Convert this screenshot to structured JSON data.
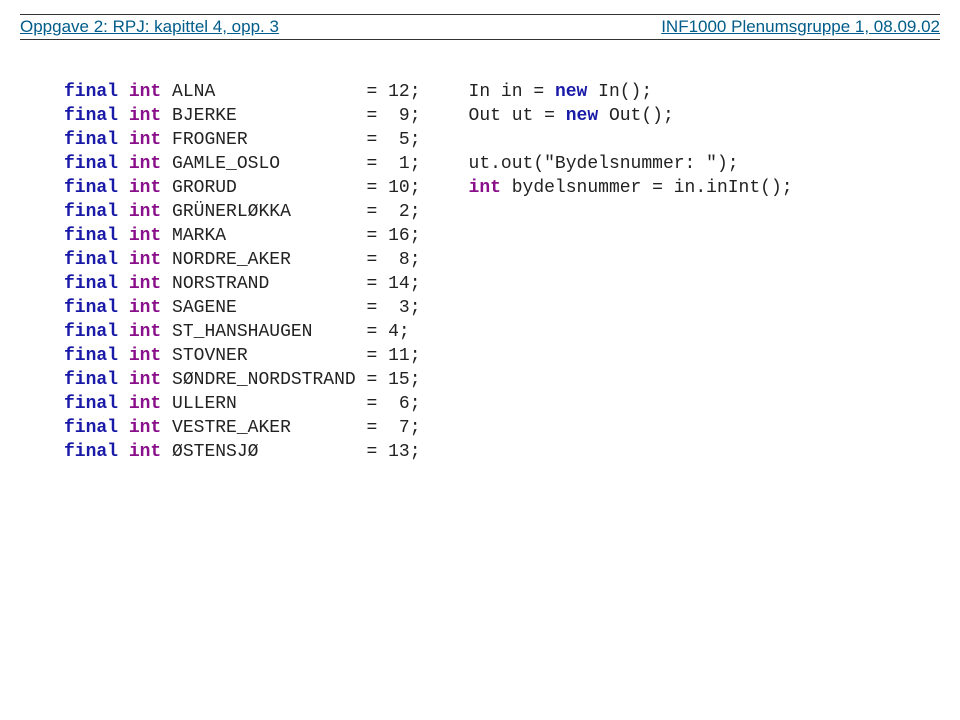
{
  "header": {
    "left": "Oppgave 2: RPJ: kapittel 4, opp. 3",
    "right": "INF1000  Plenumsgruppe 1, 08.09.02"
  },
  "code": {
    "kw_final": "final",
    "kw_int": "int",
    "kw_new": "new",
    "lines_left": [
      {
        "name": "ALNA",
        "eq": "= 12;"
      },
      {
        "name": "BJERKE",
        "eq": "=  9;"
      },
      {
        "name": "FROGNER",
        "eq": "=  5;"
      },
      {
        "name": "GAMLE_OSLO",
        "eq": "=  1;"
      },
      {
        "name": "GRORUD",
        "eq": "= 10;"
      },
      {
        "name": "GRÜNERLØKKA",
        "eq": "=  2;"
      },
      {
        "name": "MARKA",
        "eq": "= 16;"
      },
      {
        "name": "NORDRE_AKER",
        "eq": "=  8;"
      },
      {
        "name": "NORSTRAND",
        "eq": "= 14;"
      },
      {
        "name": "SAGENE",
        "eq": "=  3;"
      },
      {
        "name": "ST_HANSHAUGEN",
        "eq": "= 4;"
      },
      {
        "name": "STOVNER",
        "eq": "= 11;"
      },
      {
        "name": "SØNDRE_NORDSTRAND",
        "eq": "= 15;"
      },
      {
        "name": "ULLERN",
        "eq": "=  6;"
      },
      {
        "name": "VESTRE_AKER",
        "eq": "=  7;"
      },
      {
        "name": "ØSTENSJØ",
        "eq": "= 13;"
      }
    ],
    "right_line1_pre": "In in = ",
    "right_line1_post": " In();",
    "right_line2_pre": "Out ut = ",
    "right_line2_post": " Out();",
    "right_blank": "",
    "right_line4": "ut.out(\"Bydelsnummer: \");",
    "right_line5_pre_int": "int",
    "right_line5_body": " bydelsnummer = in.inInt();"
  }
}
